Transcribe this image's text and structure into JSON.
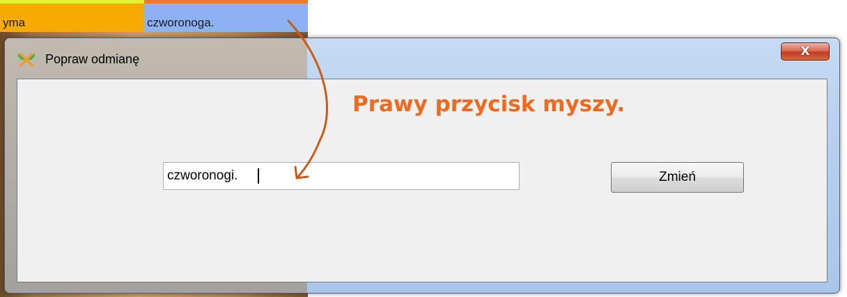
{
  "document": {
    "left_cell_text": "yma",
    "right_cell_text": "czworonoga."
  },
  "dialog": {
    "title": "Popraw odmianę",
    "close_label": "X",
    "input_value": "czworonogi.",
    "change_button_label": "Zmień"
  },
  "annotation": {
    "text": "Prawy przycisk myszy.",
    "color": "#ee6a1e"
  },
  "icons": {
    "app": "app-x-logo-icon",
    "close": "close-icon"
  }
}
